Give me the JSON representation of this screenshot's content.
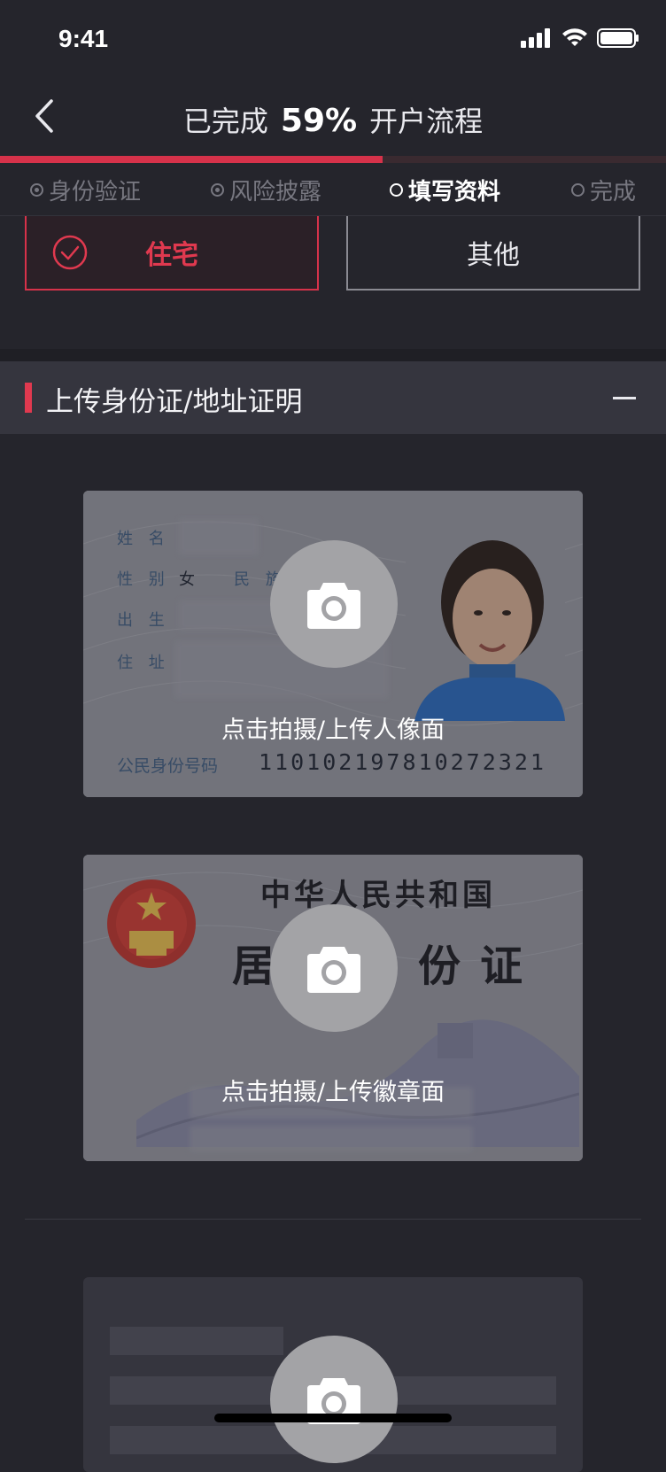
{
  "status_bar": {
    "time": "9:41"
  },
  "nav": {
    "prefix": "已完成",
    "percent": "59%",
    "suffix": "开户流程",
    "progress_fraction": 0.575
  },
  "steps": [
    {
      "label": "身份验证",
      "state": "done"
    },
    {
      "label": "风险披露",
      "state": "done"
    },
    {
      "label": "填写资料",
      "state": "active"
    },
    {
      "label": "完成",
      "state": "pending"
    }
  ],
  "address_type": {
    "selected": "住宅",
    "other": "其他"
  },
  "section": {
    "title": "上传身份证/地址证明"
  },
  "id_front": {
    "upload_label": "点击拍摄/上传人像面",
    "field_labels": {
      "name": "姓 名",
      "gender": "性 别",
      "gender_value": "女",
      "ethnicity": "民 族",
      "birth": "出 生",
      "address": "住 址",
      "id_number": "公民身份号码"
    },
    "id_number": "110102197810272321"
  },
  "id_back": {
    "upload_label": "点击拍摄/上传徽章面",
    "title_line1": "中华人民共和国",
    "title_line2": "居民身份证"
  },
  "colors": {
    "accent": "#d6324a",
    "background": "#25252c",
    "section_bg": "#35353e"
  },
  "icons": [
    "back-chevron-icon",
    "signal-icon",
    "wifi-icon",
    "battery-icon",
    "check-circle-icon",
    "minus-icon",
    "camera-icon"
  ]
}
